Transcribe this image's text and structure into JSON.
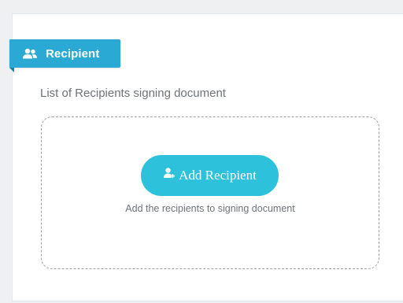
{
  "panel": {
    "header_label": "Recipient",
    "header_icon": "users-icon",
    "subtitle": "List of Recipients signing document"
  },
  "dropzone": {
    "add_button_label": "Add Recipient",
    "add_button_icon": "user-plus-icon",
    "hint": "Add the recipients to signing document"
  },
  "colors": {
    "ribbon": "#29a9d4",
    "button": "#2ec1dc",
    "text_muted": "#6e7378"
  }
}
